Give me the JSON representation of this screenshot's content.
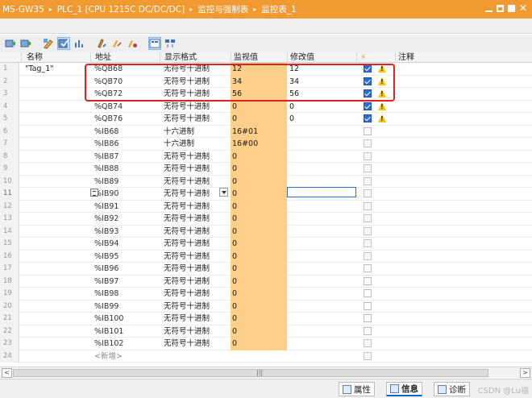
{
  "titlebar": {
    "crumbs": [
      "MS-GW35",
      "PLC_1 [CPU 1215C DC/DC/DC]",
      "监控与强制表",
      "监控表_1"
    ],
    "separator": "▸"
  },
  "toolbar": {
    "icons": [
      "monitor-all-icon",
      "monitor-once-icon",
      "modify-icon",
      "modify-now-icon",
      "trigger-icon",
      "modify-value-icon",
      "show-more-icon",
      "force-icon",
      "display-mode-icon",
      "expand-icon"
    ]
  },
  "table": {
    "headers": {
      "index": "",
      "name": "名称",
      "address": "地址",
      "format": "显示格式",
      "monitor": "监视值",
      "modify": "修改值",
      "flag": "⚡",
      "comment": "注释"
    },
    "rows": [
      {
        "num": "1",
        "name": "\"Tag_1\"",
        "addr": "%QB68",
        "fmt": "无符号十进制",
        "mon": "12",
        "mod": "12",
        "checked": true,
        "warn": true
      },
      {
        "num": "2",
        "name": "",
        "addr": "%QB70",
        "fmt": "无符号十进制",
        "mon": "34",
        "mod": "34",
        "checked": true,
        "warn": true
      },
      {
        "num": "3",
        "name": "",
        "addr": "%QB72",
        "fmt": "无符号十进制",
        "mon": "56",
        "mod": "56",
        "checked": true,
        "warn": true
      },
      {
        "num": "4",
        "name": "",
        "addr": "%QB74",
        "fmt": "无符号十进制",
        "mon": "0",
        "mod": "0",
        "checked": true,
        "warn": true
      },
      {
        "num": "5",
        "name": "",
        "addr": "%QB76",
        "fmt": "无符号十进制",
        "mon": "0",
        "mod": "0",
        "checked": true,
        "warn": true
      },
      {
        "num": "6",
        "name": "",
        "addr": "%IB68",
        "fmt": "十六进制",
        "mon": "16#01",
        "mod": "",
        "checked": false,
        "warn": false
      },
      {
        "num": "7",
        "name": "",
        "addr": "%IB86",
        "fmt": "十六进制",
        "mon": "16#00",
        "mod": "",
        "checked": false,
        "warn": false
      },
      {
        "num": "8",
        "name": "",
        "addr": "%IB87",
        "fmt": "无符号十进制",
        "mon": "0",
        "mod": "",
        "checked": false,
        "warn": false
      },
      {
        "num": "9",
        "name": "",
        "addr": "%IB88",
        "fmt": "无符号十进制",
        "mon": "0",
        "mod": "",
        "checked": false,
        "warn": false
      },
      {
        "num": "10",
        "name": "",
        "addr": "%IB89",
        "fmt": "无符号十进制",
        "mon": "0",
        "mod": "",
        "checked": false,
        "warn": false
      },
      {
        "num": "11",
        "name": "",
        "addr": "%IB90",
        "fmt": "无符号十进制",
        "mon": "0",
        "mod": "",
        "checked": false,
        "warn": false,
        "editing": true
      },
      {
        "num": "12",
        "name": "",
        "addr": "%IB91",
        "fmt": "无符号十进制",
        "mon": "0",
        "mod": "",
        "checked": false,
        "warn": false
      },
      {
        "num": "13",
        "name": "",
        "addr": "%IB92",
        "fmt": "无符号十进制",
        "mon": "0",
        "mod": "",
        "checked": false,
        "warn": false
      },
      {
        "num": "14",
        "name": "",
        "addr": "%IB93",
        "fmt": "无符号十进制",
        "mon": "0",
        "mod": "",
        "checked": false,
        "warn": false
      },
      {
        "num": "15",
        "name": "",
        "addr": "%IB94",
        "fmt": "无符号十进制",
        "mon": "0",
        "mod": "",
        "checked": false,
        "warn": false
      },
      {
        "num": "16",
        "name": "",
        "addr": "%IB95",
        "fmt": "无符号十进制",
        "mon": "0",
        "mod": "",
        "checked": false,
        "warn": false
      },
      {
        "num": "17",
        "name": "",
        "addr": "%IB96",
        "fmt": "无符号十进制",
        "mon": "0",
        "mod": "",
        "checked": false,
        "warn": false
      },
      {
        "num": "18",
        "name": "",
        "addr": "%IB97",
        "fmt": "无符号十进制",
        "mon": "0",
        "mod": "",
        "checked": false,
        "warn": false
      },
      {
        "num": "19",
        "name": "",
        "addr": "%IB98",
        "fmt": "无符号十进制",
        "mon": "0",
        "mod": "",
        "checked": false,
        "warn": false
      },
      {
        "num": "20",
        "name": "",
        "addr": "%IB99",
        "fmt": "无符号十进制",
        "mon": "0",
        "mod": "",
        "checked": false,
        "warn": false
      },
      {
        "num": "21",
        "name": "",
        "addr": "%IB100",
        "fmt": "无符号十进制",
        "mon": "0",
        "mod": "",
        "checked": false,
        "warn": false
      },
      {
        "num": "22",
        "name": "",
        "addr": "%IB101",
        "fmt": "无符号十进制",
        "mon": "0",
        "mod": "",
        "checked": false,
        "warn": false
      },
      {
        "num": "23",
        "name": "",
        "addr": "%IB102",
        "fmt": "无符号十进制",
        "mon": "0",
        "mod": "",
        "checked": false,
        "warn": false
      },
      {
        "num": "24",
        "name": "",
        "addr": "<新增>",
        "fmt": "",
        "mon": "",
        "mod": "",
        "checked": false,
        "warn": false,
        "placeholder": true
      }
    ]
  },
  "scrollbar": {
    "left": "<",
    "right": ">",
    "grip": "|||"
  },
  "statusbar": {
    "tabs": [
      {
        "label": "属性",
        "icon": "properties-icon"
      },
      {
        "label": "信息",
        "icon": "info-icon",
        "active": true
      },
      {
        "label": "诊断",
        "icon": "diagnostics-icon"
      }
    ],
    "watermark": "CSDN @Lu福"
  },
  "colors": {
    "title": "#f19a32",
    "monitor_cell": "#ffcf8a",
    "highlight_box": "#e02020"
  }
}
